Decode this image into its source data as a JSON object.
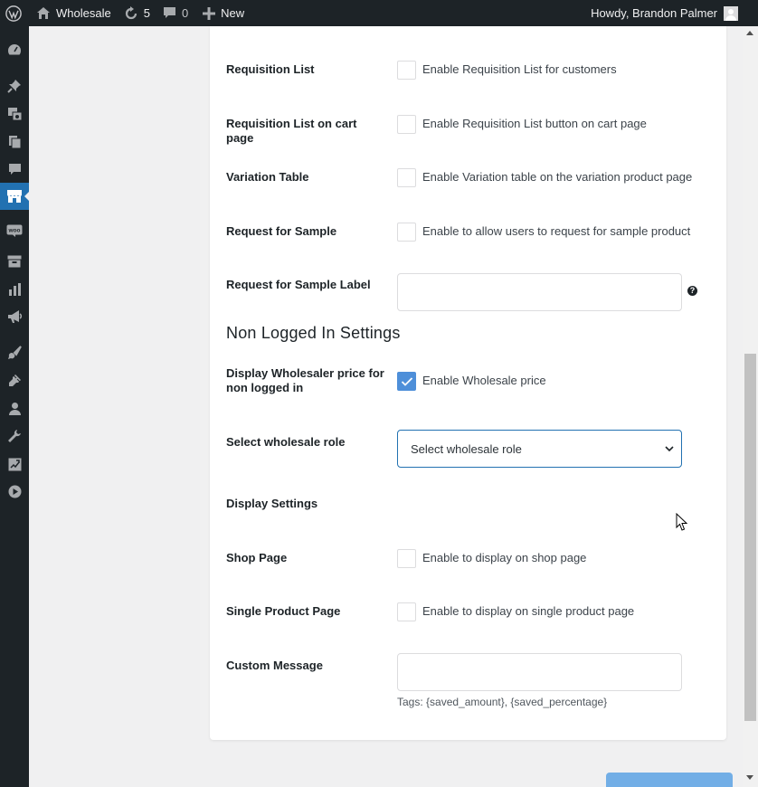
{
  "adminbar": {
    "site_name": "Wholesale",
    "updates_count": "5",
    "comments_count": "0",
    "new_label": "New",
    "greeting": "Howdy, Brandon Palmer"
  },
  "rows": {
    "requisition_list": {
      "label": "Requisition List",
      "checkbox_label": "Enable Requisition List for customers",
      "checked": false
    },
    "requisition_cart": {
      "label": "Requisition List on cart page",
      "checkbox_label": "Enable Requisition List button on cart page",
      "checked": false
    },
    "variation_table": {
      "label": "Variation Table",
      "checkbox_label": "Enable Variation table on the variation product page",
      "checked": false
    },
    "request_sample": {
      "label": "Request for Sample",
      "checkbox_label": "Enable to allow users to request for sample product",
      "checked": false
    },
    "request_sample_label": {
      "label": "Request for Sample Label",
      "value": "",
      "help_icon": "?"
    }
  },
  "non_logged": {
    "section_title": "Non Logged In Settings",
    "display_price": {
      "label": "Display Wholesaler price for non logged in",
      "checkbox_label": "Enable Wholesale price",
      "checked": true
    },
    "select_role": {
      "label": "Select wholesale role",
      "selected": "Select wholesale role"
    },
    "display_settings_label": "Display Settings",
    "shop_page": {
      "label": "Shop Page",
      "checkbox_label": "Enable to display on shop page",
      "checked": false
    },
    "single_product": {
      "label": "Single Product Page",
      "checkbox_label": "Enable to display on single product page",
      "checked": false
    },
    "custom_message": {
      "label": "Custom Message",
      "value": "",
      "tags": "Tags: {saved_amount}, {saved_percentage}"
    }
  },
  "colors": {
    "accent": "#2271b1",
    "checked": "#4e8fd9",
    "adminbar": "#1d2327",
    "button": "#72aee6"
  },
  "icons": [
    "wordpress-logo-icon",
    "home-icon",
    "updates-icon",
    "comments-icon",
    "plus-icon",
    "avatar",
    "dashboard-icon",
    "pin-icon",
    "media-icon",
    "pages-icon",
    "comment-icon",
    "store-icon",
    "woo-icon",
    "archive-icon",
    "analytics-icon",
    "megaphone-icon",
    "brush-icon",
    "plugin-icon",
    "user-icon",
    "wrench-icon",
    "settings-icon",
    "play-icon",
    "question-icon",
    "chevron-down-icon",
    "checkmark-icon"
  ]
}
